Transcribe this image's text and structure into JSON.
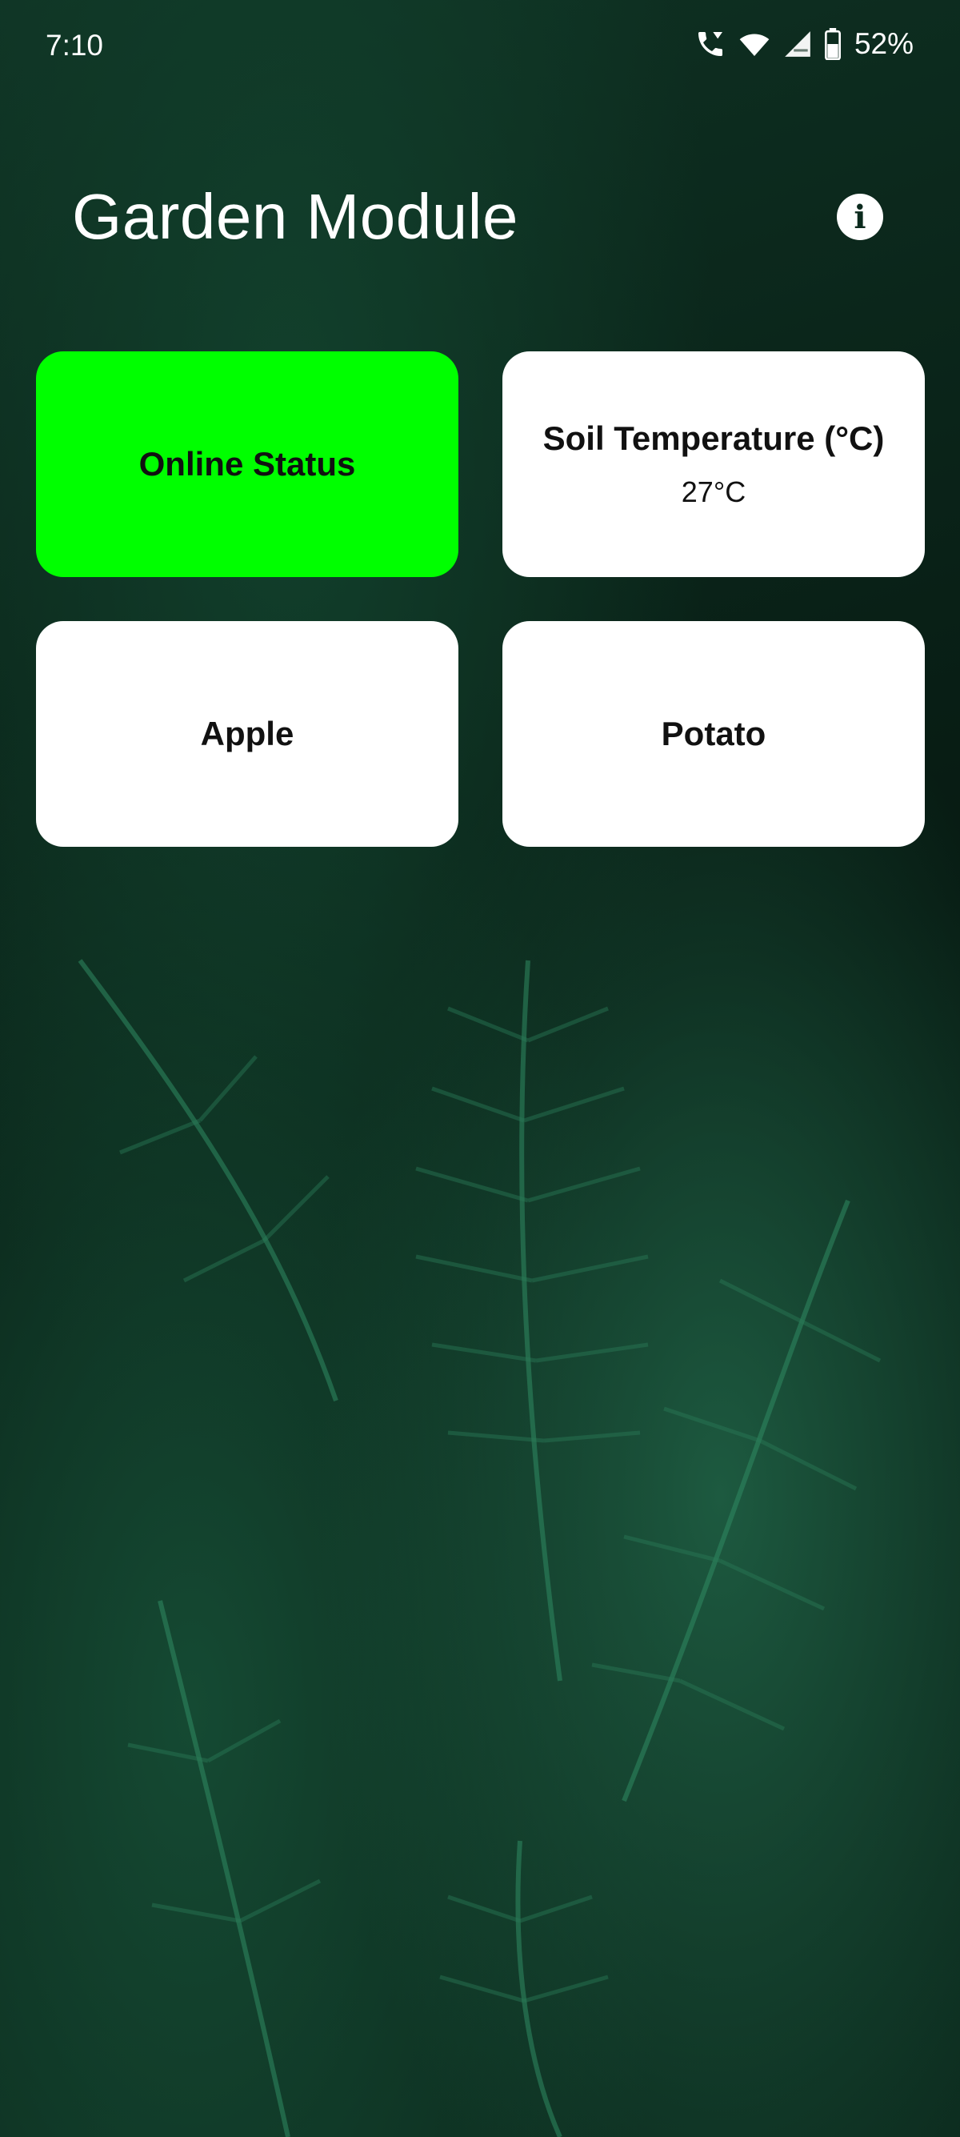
{
  "status_bar": {
    "time": "7:10",
    "battery": "52%",
    "icons": [
      "wifi-call-icon",
      "wifi-icon",
      "signal-icon",
      "battery-icon"
    ]
  },
  "header": {
    "title": "Garden Module",
    "info_icon": "info-icon"
  },
  "cards": {
    "online_status": {
      "label": "Online Status",
      "color": "#00ff00"
    },
    "soil_temperature": {
      "label": "Soil Temperature (°C)",
      "value": "27°C",
      "color": "#ffffff"
    },
    "apple": {
      "label": "Apple",
      "color": "#ffffff"
    },
    "potato": {
      "label": "Potato",
      "color": "#ffffff"
    }
  }
}
